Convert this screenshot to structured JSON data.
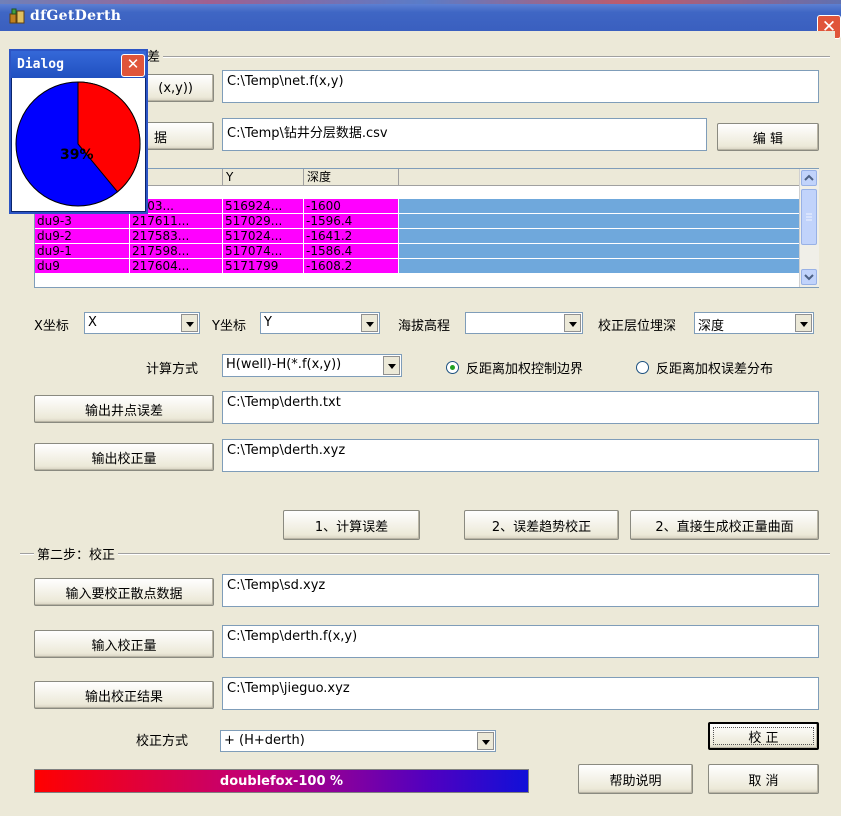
{
  "window": {
    "title": "dfGetDerth",
    "close_glyph": "✕",
    "icon": "app-icon"
  },
  "step1": {
    "group_label": "差",
    "input_grid_btn": "(x,y))",
    "input_grid_path": "C:\\Temp\\net.f(x,y)",
    "input_well_btn": "据",
    "input_well_path": "C:\\Temp\\钻井分层数据.csv",
    "edit_btn": "编 辑"
  },
  "grid": {
    "columns": [
      "",
      "",
      "Y",
      "深度"
    ],
    "rows": [
      [
        "",
        "7603...",
        "516924...",
        "-1600"
      ],
      [
        "du9-3",
        "217611...",
        "517029...",
        "-1596.4"
      ],
      [
        "du9-2",
        "217583...",
        "517024...",
        "-1641.2"
      ],
      [
        "du9-1",
        "217598...",
        "517074...",
        "-1586.4"
      ],
      [
        "du9",
        "217604...",
        "5171799",
        "-1608.2"
      ]
    ],
    "row_color": "#ff00ff",
    "fill_color": "#6fa8dc"
  },
  "fields": {
    "x_label": "X坐标",
    "x_value": "X",
    "y_label": "Y坐标",
    "y_value": "Y",
    "elev_label": "海拔高程",
    "elev_value": "",
    "depth_label": "校正层位埋深",
    "depth_value": "深度"
  },
  "calc": {
    "method_label": "计算方式",
    "method_value": "H(well)-H(*.f(x,y))",
    "radio1": "反距离加权控制边界",
    "radio1_checked": true,
    "radio2": "反距离加权误差分布",
    "radio2_checked": false
  },
  "outputs": {
    "well_err_btn": "输出井点误差",
    "well_err_path": "C:\\Temp\\derth.txt",
    "corr_btn": "输出校正量",
    "corr_path": "C:\\Temp\\derth.xyz"
  },
  "actions": {
    "calc_err": "1、计算误差",
    "trend_corr": "2、误差趋势校正",
    "direct_surface": "2、直接生成校正量曲面"
  },
  "step2": {
    "group_label": "第二步：校正",
    "input_scatter_btn": "输入要校正散点数据",
    "input_scatter_path": "C:\\Temp\\sd.xyz",
    "input_corr_btn": "输入校正量",
    "input_corr_path": "C:\\Temp\\derth.f(x,y)",
    "output_result_btn": "输出校正结果",
    "output_result_path": "C:\\Temp\\jieguo.xyz",
    "mode_label": "校正方式",
    "mode_value": "+ (H+derth)",
    "apply_btn": "校 正"
  },
  "footer": {
    "progress_text": "doublefox-100 %",
    "progress_value": 1.0,
    "help_btn": "帮助说明",
    "cancel_btn": "取 消"
  },
  "dialog": {
    "title": "Dialog",
    "close_glyph": "✕",
    "percent_text": "39%",
    "percent_value": 39,
    "colors": {
      "done": "#ff0000",
      "remaining": "#0000ff"
    }
  }
}
